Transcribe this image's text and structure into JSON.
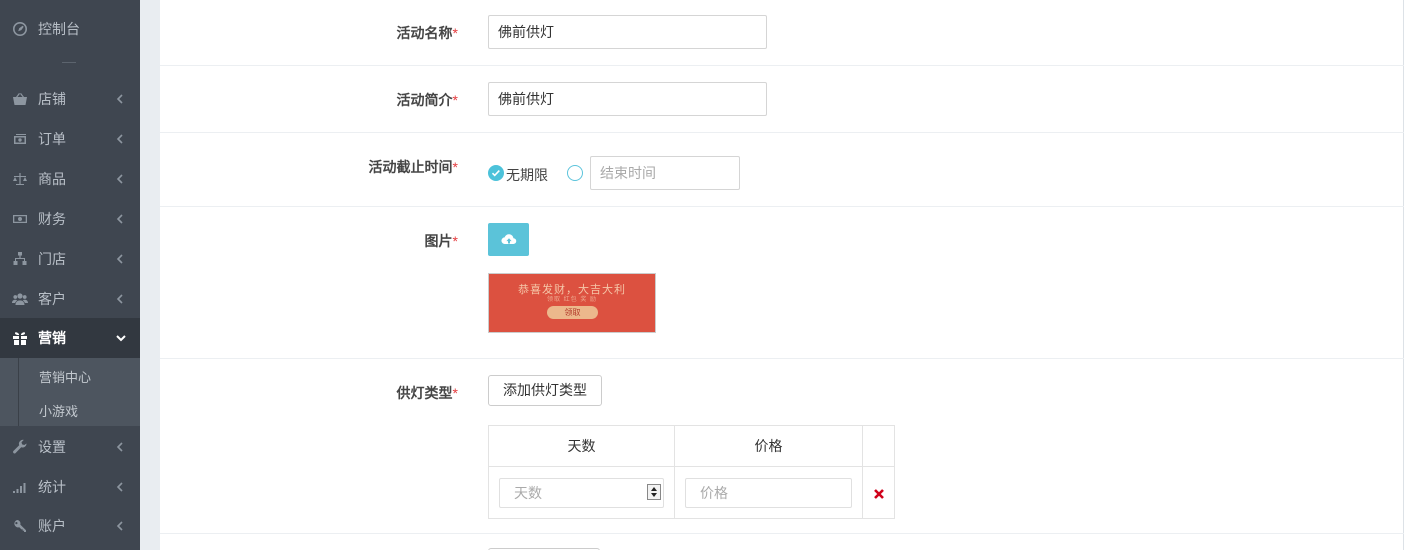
{
  "sidebar": {
    "items": [
      {
        "key": "dashboard",
        "label": "控制台",
        "icon": "dashboard-icon"
      },
      {
        "key": "shop",
        "label": "店铺",
        "icon": "basket-icon"
      },
      {
        "key": "orders",
        "label": "订单",
        "icon": "money-icon"
      },
      {
        "key": "goods",
        "label": "商品",
        "icon": "balance-scale-icon"
      },
      {
        "key": "finance",
        "label": "财务",
        "icon": "cash-icon"
      },
      {
        "key": "stores",
        "label": "门店",
        "icon": "sitemap-icon"
      },
      {
        "key": "customers",
        "label": "客户",
        "icon": "users-icon"
      },
      {
        "key": "marketing",
        "label": "营销",
        "icon": "gift-icon"
      },
      {
        "key": "settings",
        "label": "设置",
        "icon": "wrench-icon"
      },
      {
        "key": "stats",
        "label": "统计",
        "icon": "signal-icon"
      },
      {
        "key": "account",
        "label": "账户",
        "icon": "key-icon"
      }
    ],
    "marketing_sub": [
      "营销中心",
      "小游戏"
    ],
    "active": "marketing"
  },
  "form": {
    "name": {
      "label": "活动名称",
      "required": "*",
      "value": "佛前供灯"
    },
    "intro": {
      "label": "活动简介",
      "required": "*",
      "value": "佛前供灯"
    },
    "deadline": {
      "label": "活动截止时间",
      "required": "*",
      "unlimited_label": "无期限",
      "unlimited_selected": true,
      "end_time_placeholder": "结束时间"
    },
    "image": {
      "label": "图片",
      "required": "*",
      "upload_icon": "cloud-upload-icon",
      "preview": {
        "headline": "恭喜发财，大吉大利",
        "subline": "领取 红包 奖 励",
        "button": "领取"
      }
    },
    "lamp_type": {
      "label": "供灯类型",
      "required": "*",
      "add_button": "添加供灯类型",
      "columns": [
        "天数",
        "价格"
      ],
      "rows": [
        {
          "days_placeholder": "天数",
          "price_placeholder": "价格",
          "delete_icon": "close-icon"
        }
      ]
    }
  },
  "colors": {
    "sidebar_bg": "#3f4650",
    "accent": "#5bc3d9",
    "required": "#e4393c",
    "delete": "#d0021b"
  }
}
